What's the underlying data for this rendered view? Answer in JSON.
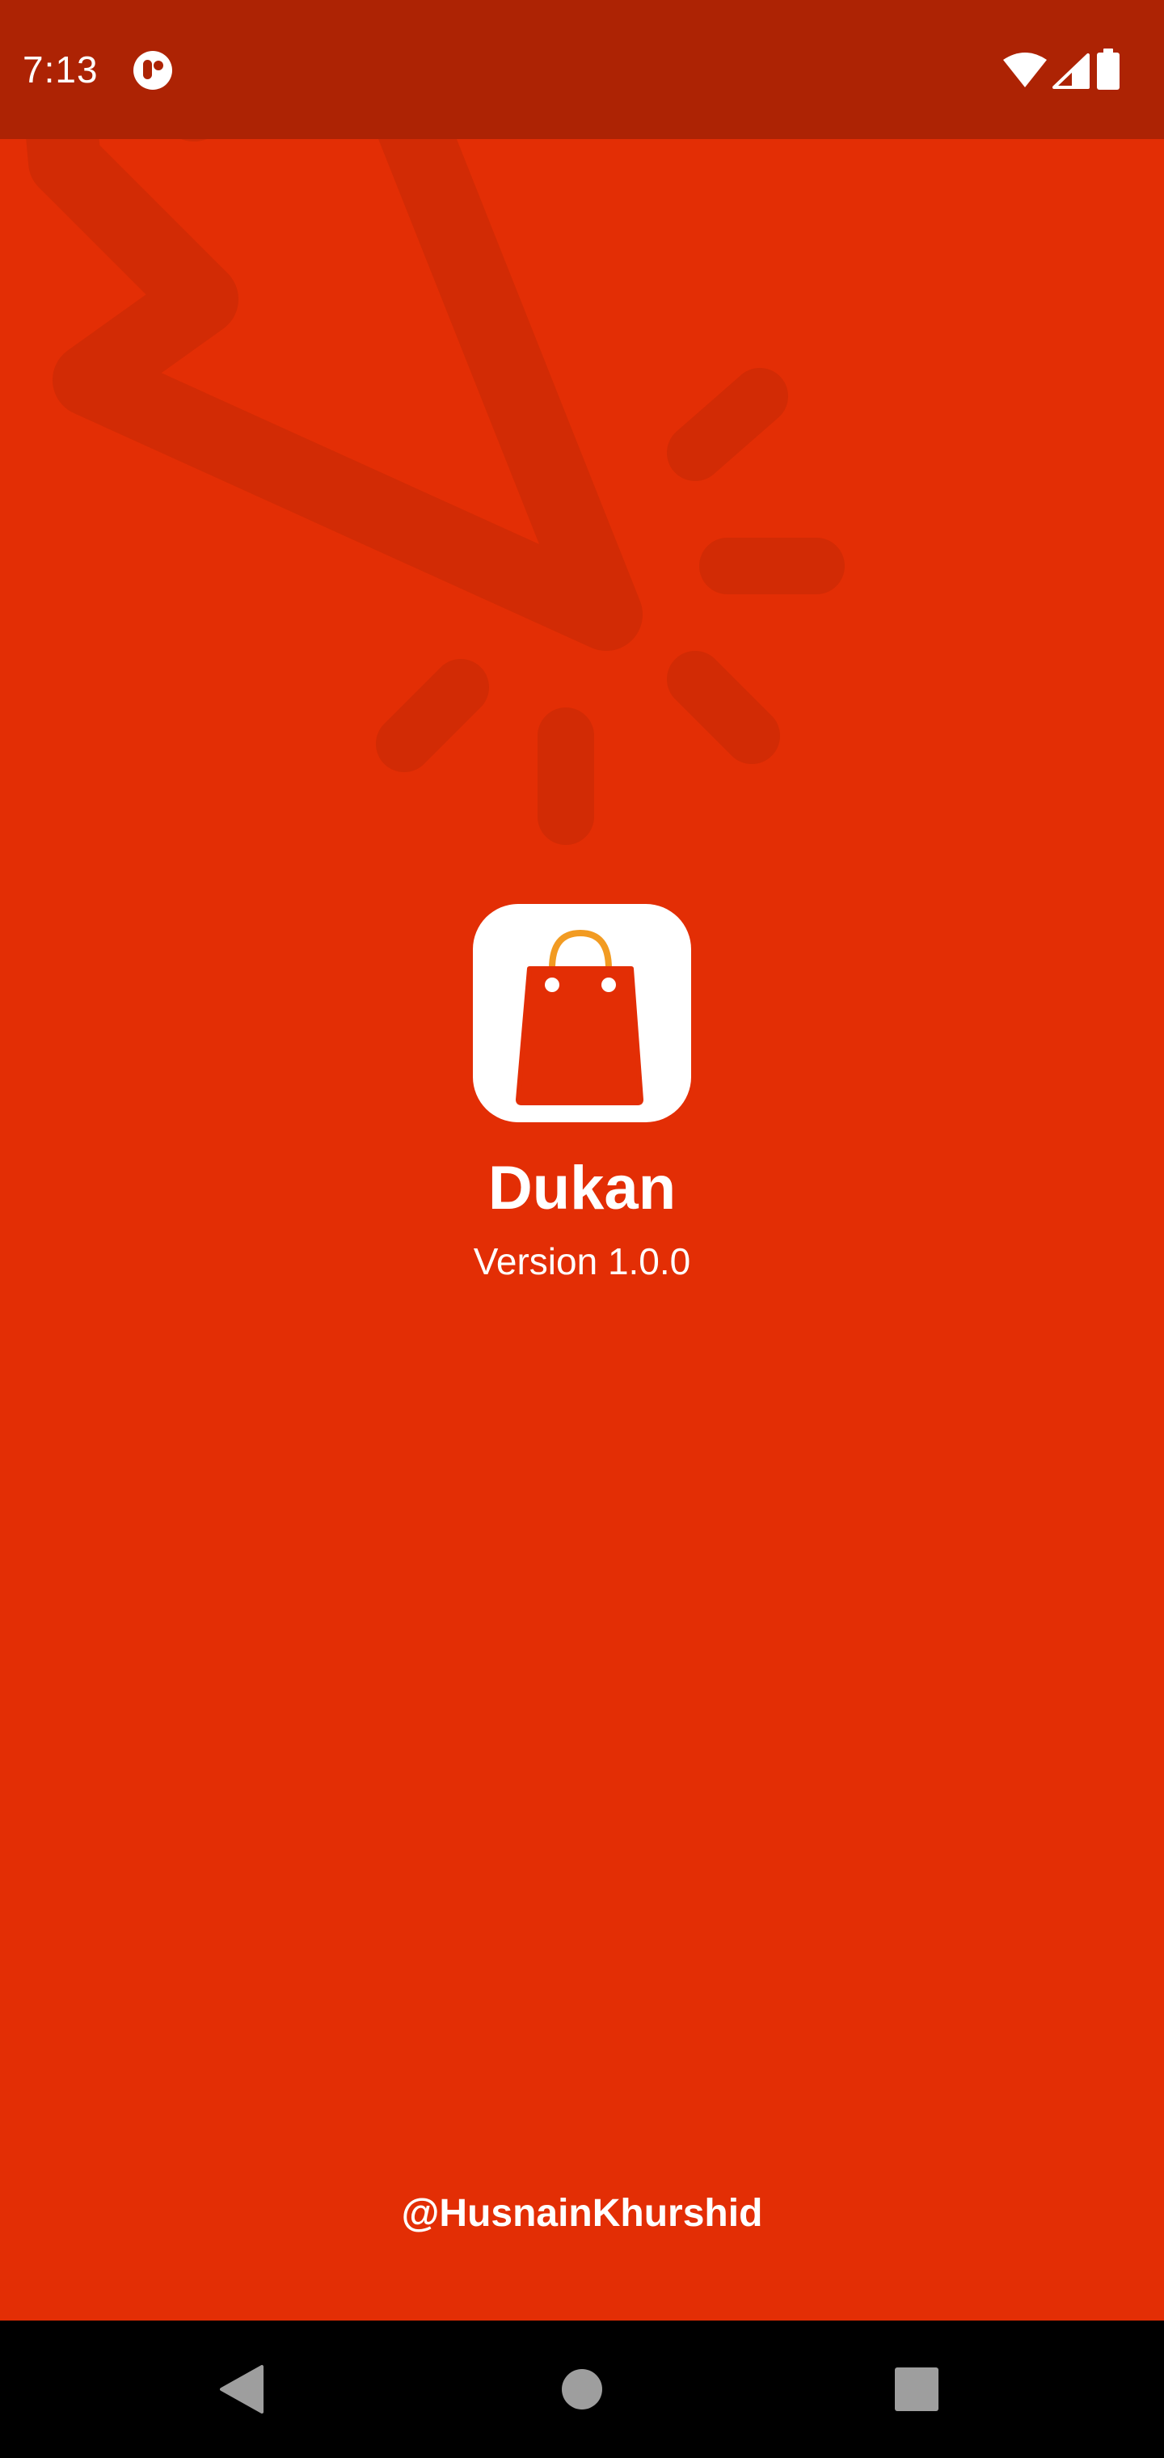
{
  "status_bar": {
    "time": "7:13",
    "notification_icon": "app-notification-icon",
    "icons": [
      "wifi-icon",
      "cellular-signal-icon",
      "battery-icon"
    ]
  },
  "splash": {
    "app_name": "Dukan",
    "version": "Version 1.0.0",
    "author": "@HusnainKhurshid",
    "logo_icon": "shopping-bag-icon"
  },
  "nav_bar": {
    "icons": [
      "back-icon",
      "home-icon",
      "recents-icon"
    ]
  },
  "colors": {
    "background": "#e32e05",
    "status_bar": "#ad2304",
    "decoration": "#d22b05",
    "logo_background": "#ffffff",
    "bag_body": "#e32e05",
    "bag_handle": "#f29b22",
    "nav_bar": "#000000",
    "nav_icons": "#9e9e9e"
  }
}
